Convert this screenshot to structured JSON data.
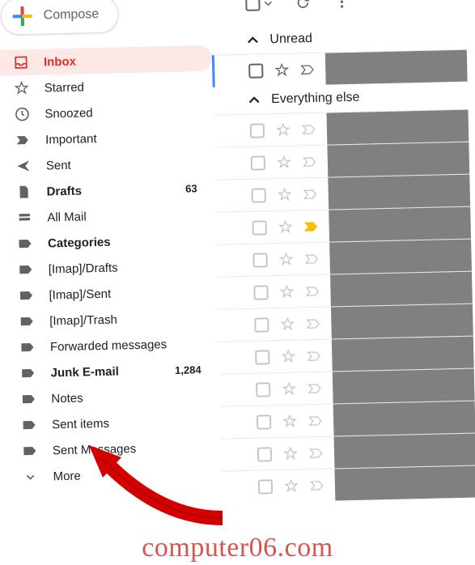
{
  "compose": {
    "label": "Compose"
  },
  "sidebar": {
    "items": [
      {
        "id": "inbox",
        "label": "Inbox",
        "icon": "inbox",
        "active": true
      },
      {
        "id": "starred",
        "label": "Starred",
        "icon": "star"
      },
      {
        "id": "snoozed",
        "label": "Snoozed",
        "icon": "clock"
      },
      {
        "id": "important",
        "label": "Important",
        "icon": "important"
      },
      {
        "id": "sent",
        "label": "Sent",
        "icon": "send"
      },
      {
        "id": "drafts",
        "label": "Drafts",
        "icon": "file",
        "bold": true,
        "count": "63"
      },
      {
        "id": "allmail",
        "label": "All Mail",
        "icon": "stack"
      },
      {
        "id": "categories",
        "label": "Categories",
        "icon": "label",
        "bold": true
      },
      {
        "id": "imap-drafts",
        "label": "[Imap]/Drafts",
        "icon": "label"
      },
      {
        "id": "imap-sent",
        "label": "[Imap]/Sent",
        "icon": "label"
      },
      {
        "id": "imap-trash",
        "label": "[Imap]/Trash",
        "icon": "label"
      },
      {
        "id": "forwarded",
        "label": "Forwarded messages",
        "icon": "label"
      },
      {
        "id": "junk",
        "label": "Junk E-mail",
        "icon": "label",
        "bold": true,
        "count": "1,284"
      },
      {
        "id": "notes",
        "label": "Notes",
        "icon": "label"
      },
      {
        "id": "sentitems",
        "label": "Sent items",
        "icon": "label"
      },
      {
        "id": "sentmsgs",
        "label": "Sent Messages",
        "icon": "label"
      },
      {
        "id": "more",
        "label": "More",
        "icon": "chevron-down"
      }
    ]
  },
  "sections": {
    "unread": "Unread",
    "else": "Everything else"
  },
  "watermark": "computer06.com"
}
